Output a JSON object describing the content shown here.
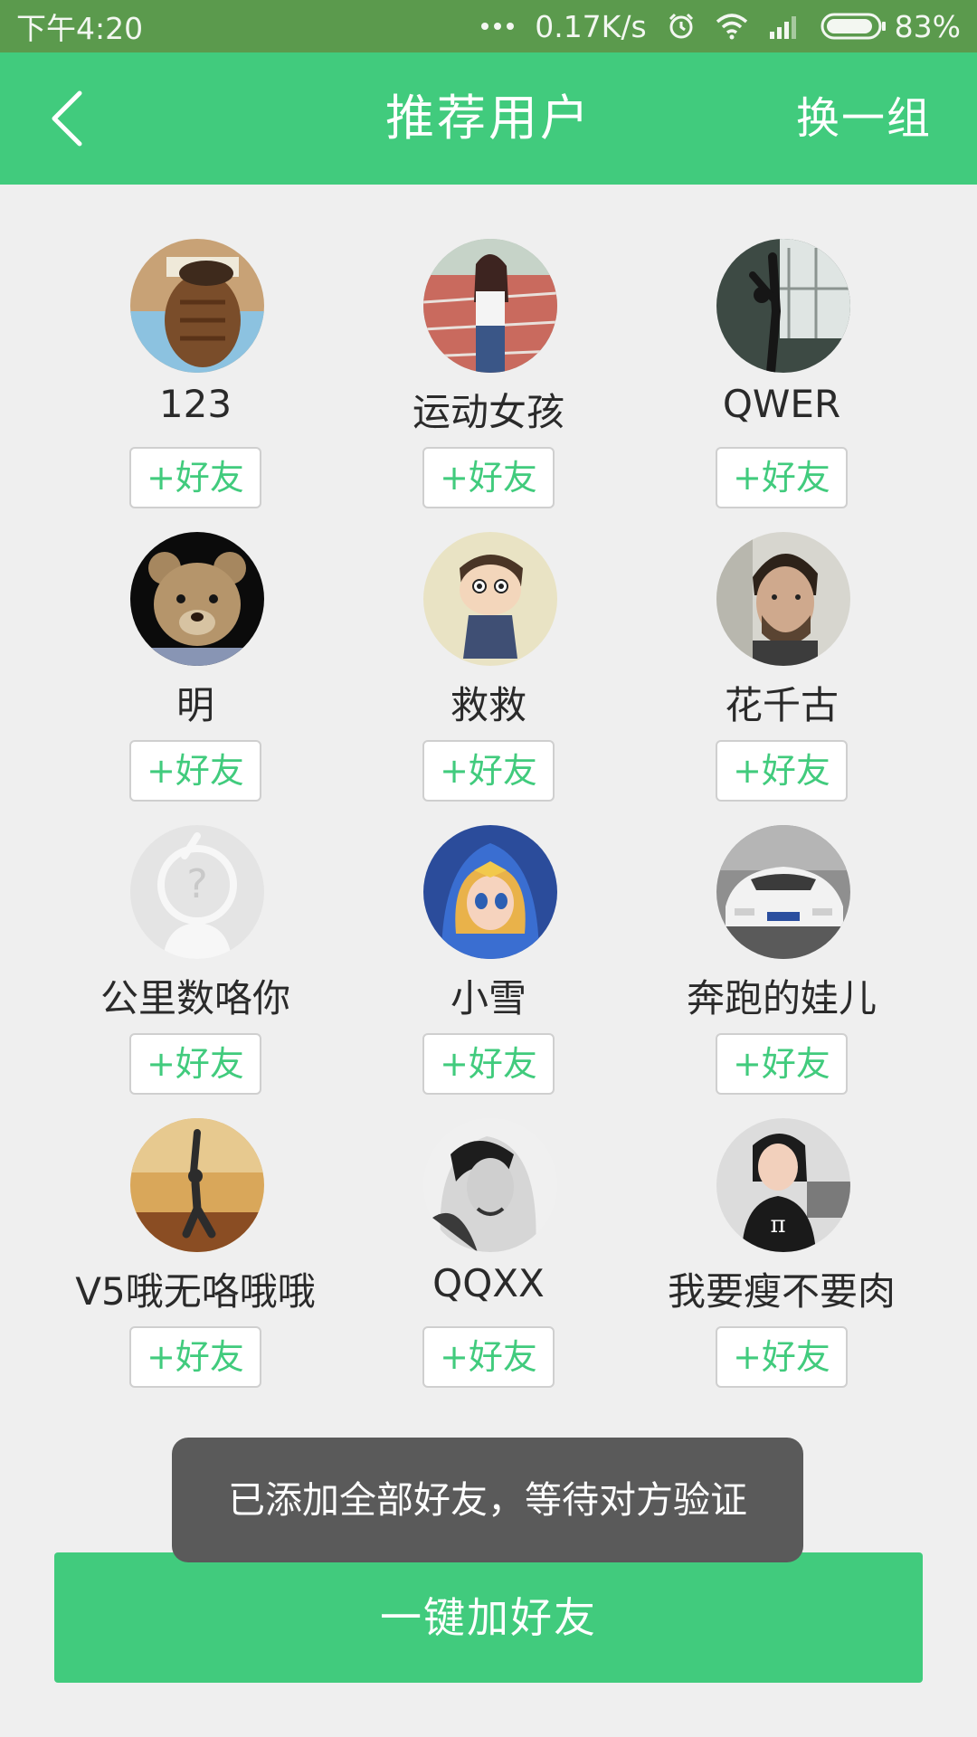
{
  "status_bar": {
    "time": "下午4:20",
    "network_speed": "0.17K/s",
    "battery_percent": "83%",
    "icons": [
      "more-dots-icon",
      "alarm-icon",
      "wifi-icon",
      "signal-icon",
      "battery-icon"
    ]
  },
  "header": {
    "title": "推荐用户",
    "refresh_label": "换一组",
    "back_icon": "chevron-left-icon",
    "color": "#41cb7d"
  },
  "users": [
    {
      "name": "123",
      "add_label": "+好友",
      "avatar": "muscular-warrior-avatar"
    },
    {
      "name": "运动女孩",
      "add_label": "+好友",
      "avatar": "girl-on-track-avatar"
    },
    {
      "name": "QWER",
      "add_label": "+好友",
      "avatar": "dancer-stretch-avatar"
    },
    {
      "name": "明",
      "add_label": "+好友",
      "avatar": "teddy-bear-avatar"
    },
    {
      "name": "救救",
      "add_label": "+好友",
      "avatar": "cartoon-boy-avatar"
    },
    {
      "name": "花千古",
      "add_label": "+好友",
      "avatar": "bearded-man-avatar"
    },
    {
      "name": "公里数咯你",
      "add_label": "+好友",
      "avatar": "default-question-avatar"
    },
    {
      "name": "小雪",
      "add_label": "+好友",
      "avatar": "game-princess-avatar"
    },
    {
      "name": "奔跑的娃儿",
      "add_label": "+好友",
      "avatar": "white-car-avatar"
    },
    {
      "name": "V5哦无咯哦哦",
      "add_label": "+好友",
      "avatar": "yoga-woman-avatar"
    },
    {
      "name": "QQXX",
      "add_label": "+好友",
      "avatar": "blonde-woman-bw-avatar"
    },
    {
      "name": "我要瘦不要肉",
      "add_label": "+好友",
      "avatar": "office-woman-avatar"
    }
  ],
  "toast": {
    "message": "已添加全部好友，等待对方验证"
  },
  "bottom_button": {
    "label": "一键加好友"
  },
  "colors": {
    "accent": "#41cb7d",
    "status_bar": "#5b9a4d",
    "background": "#efefef",
    "toast": "#5a5a5a"
  }
}
